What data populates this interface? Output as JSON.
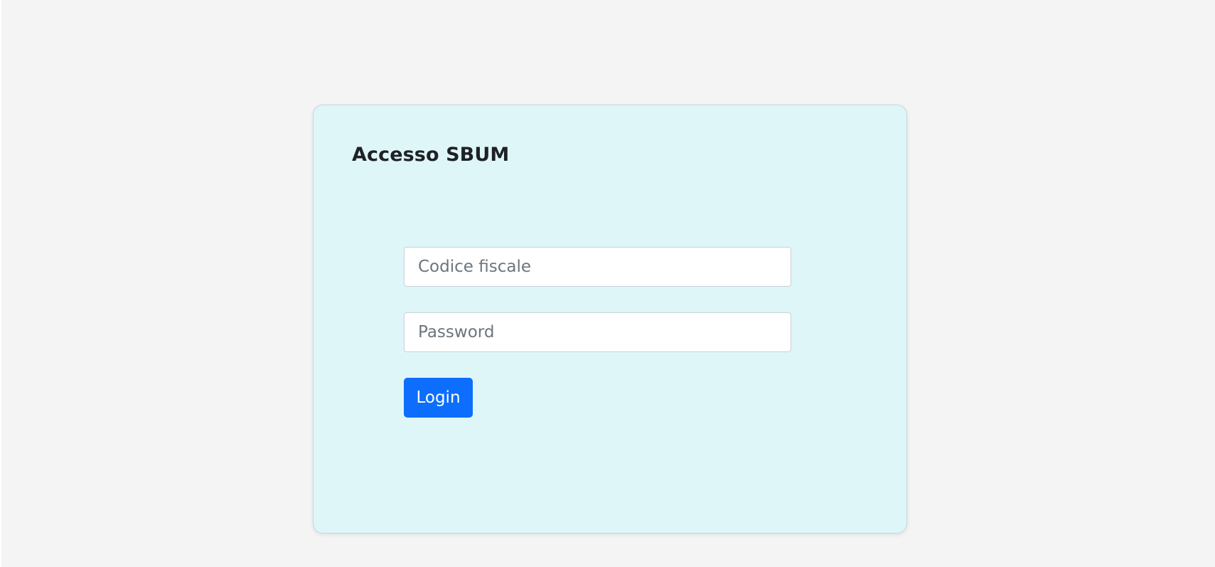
{
  "login_card": {
    "title": "Accesso SBUM",
    "fiscal_code_placeholder": "Codice fiscale",
    "password_placeholder": "Password",
    "login_label": "Login"
  },
  "colors": {
    "page_background": "#f4f4f4",
    "card_background": "#dff6f9",
    "primary_button": "#0d6efd"
  }
}
